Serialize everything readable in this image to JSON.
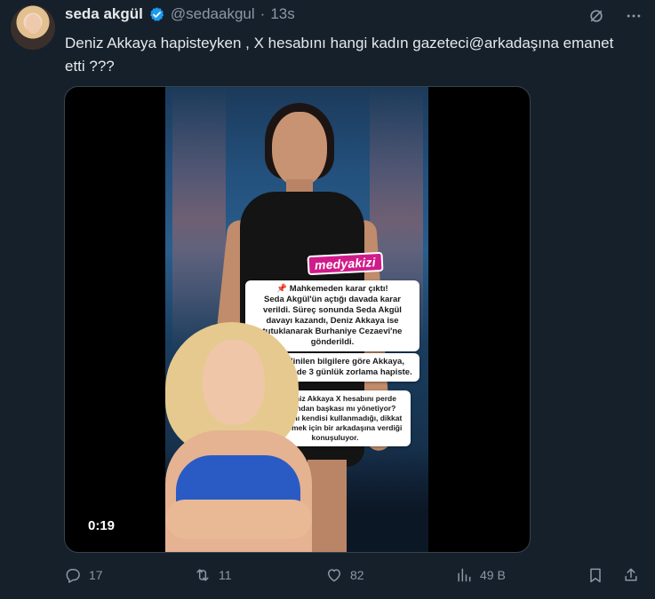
{
  "tweet": {
    "author_name": "seda akgül",
    "handle": "@sedaakgul",
    "separator": "·",
    "time": "13s",
    "text": "Deniz Akkaya hapisteyken , X hesabını hangi kadın gazeteci@arkadaşına emanet etti ???"
  },
  "media": {
    "video_time": "0:19",
    "logo_text": "medyakizi",
    "box1": {
      "lines": [
        "Mahkemeden karar çıktı!",
        "Seda Akgül'ün açtığı davada karar",
        "verildi. Süreç sonunda Seda Akgül",
        "davayı kazandı, Deniz Akkaya ise",
        "tutuklanarak Burhaniye Cezaevi'ne",
        "gönderildi."
      ]
    },
    "box2": {
      "lines": [
        "Edinilen bilgilere göre Akkaya,",
        "cezaevinde 3 günlük zorlama hapiste."
      ]
    },
    "box3": {
      "lines": [
        "Deniz Akkaya X hesabını perde",
        "arkasından başkası mı yönetiyor?",
        "Hesabını kendisi kullanmadığı, dikkat",
        "çekmemek için bir arkadaşına verdiği",
        "konuşuluyor."
      ]
    },
    "pin_glyph": "📌"
  },
  "actions": {
    "replies": "17",
    "reposts": "11",
    "likes": "82",
    "views": "49 B"
  },
  "icons": {
    "verified": "verified-badge-icon",
    "grok": "grok-icon",
    "more": "more-icon",
    "reply": "reply-icon",
    "repost": "repost-icon",
    "like": "heart-icon",
    "views": "views-icon",
    "bookmark": "bookmark-icon",
    "share": "share-icon"
  },
  "colors": {
    "background": "#15202b",
    "text": "#e7e9ea",
    "muted": "#8b98a5",
    "verified": "#1d9bf0",
    "logo": "#d11b8a"
  }
}
